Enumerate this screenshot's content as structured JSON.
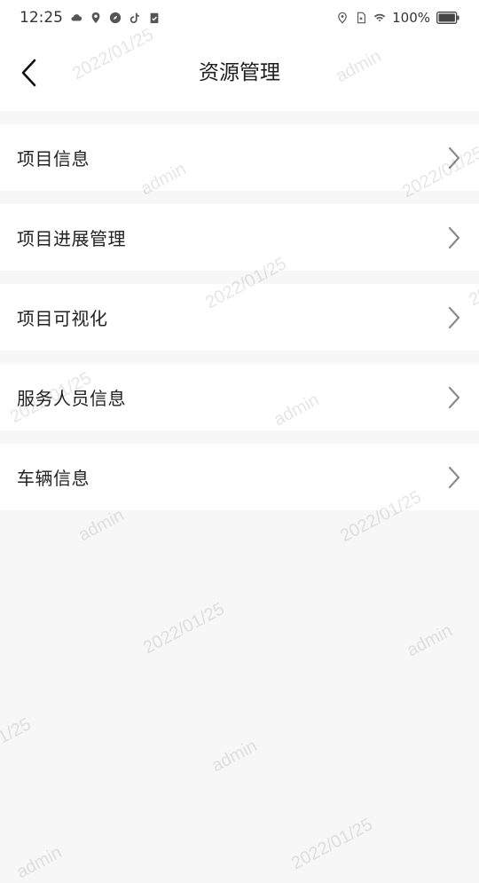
{
  "status": {
    "time": "12:25",
    "battery": "100%",
    "left_icons": [
      "cloud-icon",
      "location-pin-icon",
      "compass-icon",
      "tiktok-icon",
      "clipboard-check-icon"
    ],
    "right_icons": [
      "location-icon",
      "sim-icon",
      "wifi-icon",
      "battery-icon"
    ]
  },
  "header": {
    "title": "资源管理",
    "back_icon": "chevron-left-icon"
  },
  "menu": {
    "items": [
      {
        "label": "项目信息"
      },
      {
        "label": "项目进展管理"
      },
      {
        "label": "项目可视化"
      },
      {
        "label": "服务人员信息"
      },
      {
        "label": "车辆信息"
      }
    ]
  },
  "watermark": {
    "user": "admin",
    "date": "2022/01/25"
  },
  "colors": {
    "background": "#f7f7f7",
    "card": "#ffffff",
    "chevron": "#8a8a8a"
  }
}
